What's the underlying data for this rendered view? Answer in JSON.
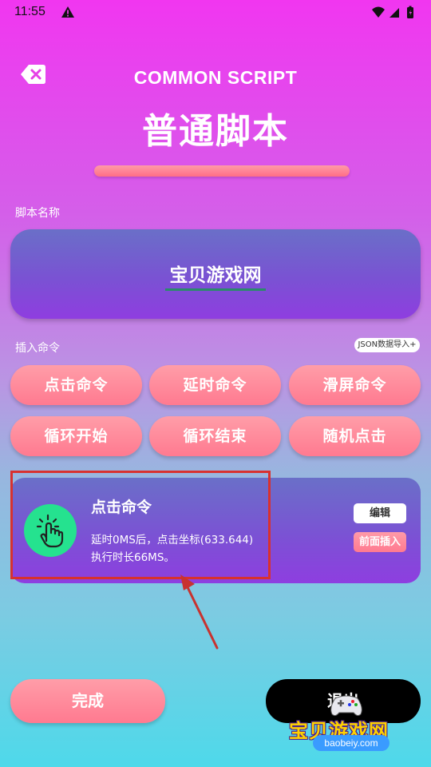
{
  "status_bar": {
    "time": "11:55"
  },
  "header": {
    "title_en": "COMMON SCRIPT",
    "title_cn": "普通脚本"
  },
  "script_name": {
    "label": "脚本名称",
    "value": "宝贝游戏网"
  },
  "insert": {
    "label": "插入命令",
    "json_button": "JSON数据导入+",
    "buttons": [
      "点击命令",
      "延时命令",
      "滑屏命令",
      "循环开始",
      "循环结束",
      "随机点击"
    ]
  },
  "command_item": {
    "title": "点击命令",
    "line1": "延时0MS后，点击坐标(633.644)",
    "line2": "执行时长66MS。",
    "edit_label": "编辑",
    "insert_before_label": "前面插入"
  },
  "footer": {
    "done_label": "完成",
    "exit_label": "退出"
  },
  "watermark": {
    "text": "宝贝游戏网",
    "url": "baobeiy.com"
  },
  "colors": {
    "accent_pink": "#ff7a90",
    "card_purple": "#7a52d3",
    "icon_green": "#25e28f",
    "highlight_red": "#d8312f"
  }
}
